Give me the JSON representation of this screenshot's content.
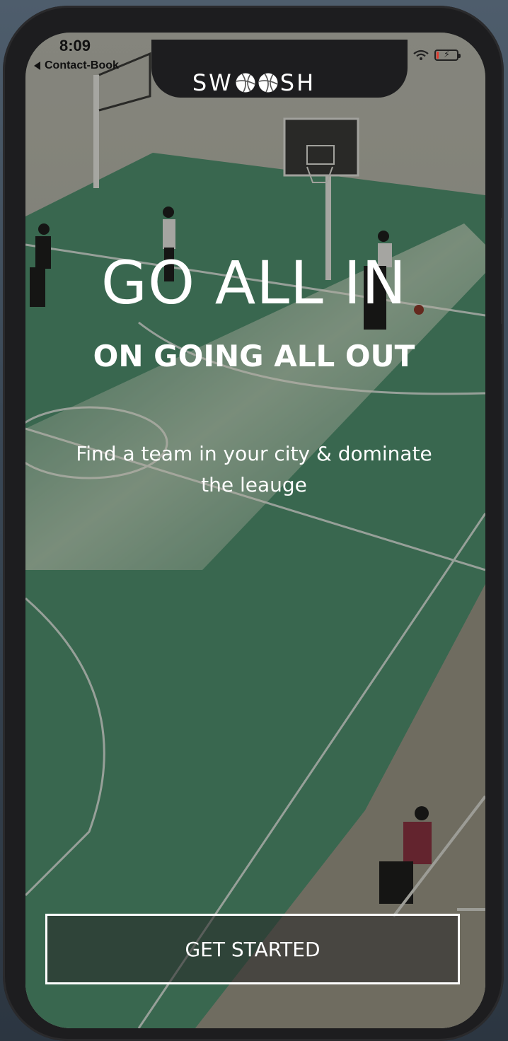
{
  "status_bar": {
    "time": "8:09",
    "back_label": "Contact-Book",
    "battery_level": 0.1
  },
  "logo": {
    "prefix": "SW",
    "suffix": "SH"
  },
  "hero": {
    "headline": "GO ALL IN",
    "subheadline": "ON GOING ALL OUT",
    "tagline": "Find a team in your city & dominate the leauge"
  },
  "cta": {
    "label": "GET STARTED"
  },
  "icons": {
    "back": "back-arrow-icon",
    "wifi": "wifi-icon",
    "battery": "battery-icon",
    "ball": "basketball-icon"
  },
  "colors": {
    "text": "#ffffff",
    "court_green": "#3f7a5c",
    "battery_low": "#e03a2f"
  }
}
